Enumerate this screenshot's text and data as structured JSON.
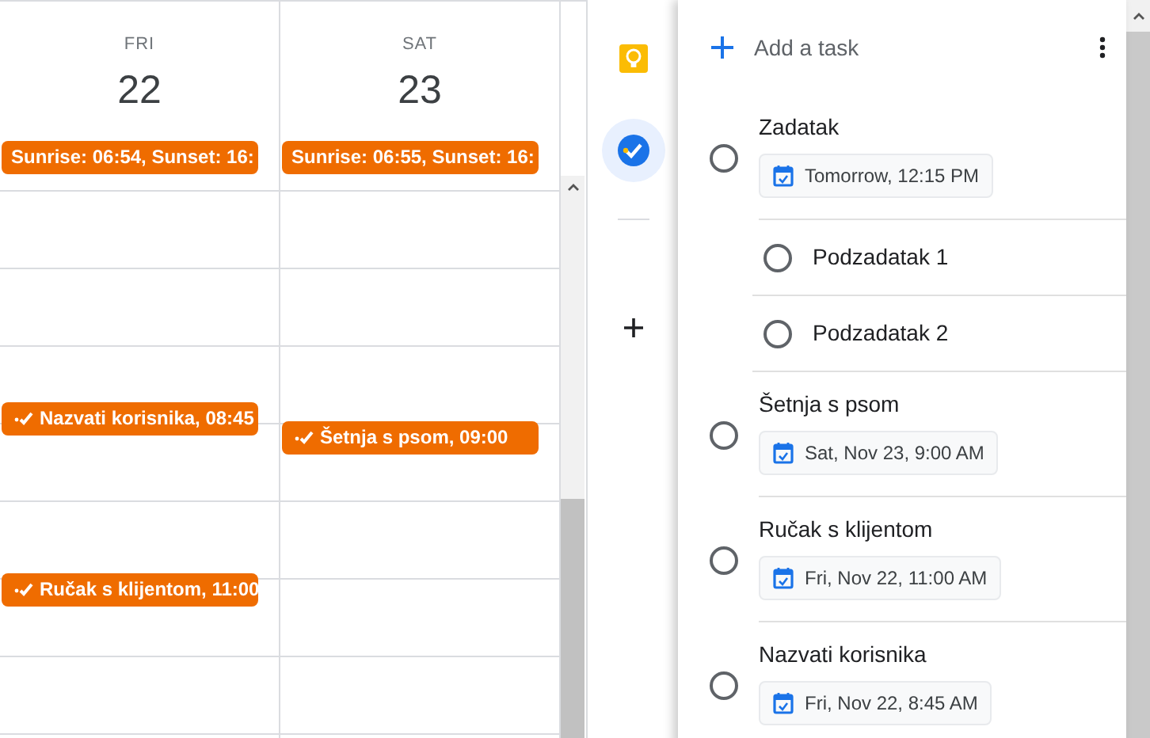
{
  "calendar": {
    "days": [
      {
        "name": "FRI",
        "date": "22",
        "all_day": "Sunrise: 06:54, Sunset: 16:",
        "events": [
          {
            "label": "Nazvati korisnika, 08:45"
          },
          {
            "label": "Ručak s klijentom, 11:00"
          }
        ]
      },
      {
        "name": "SAT",
        "date": "23",
        "all_day": "Sunrise: 06:55, Sunset: 16:",
        "events": [
          {
            "label": "Šetnja s psom, 09:00"
          }
        ]
      }
    ]
  },
  "side_rail": {
    "items": [
      {
        "kind": "keep",
        "selected": false
      },
      {
        "kind": "tasks",
        "selected": true
      },
      {
        "kind": "add",
        "selected": false
      }
    ]
  },
  "tasks_panel": {
    "add_task": {
      "placeholder": "Add a task"
    },
    "tasks": [
      {
        "title": "Zadatak",
        "due": "Tomorrow, 12:15 PM",
        "completed": false,
        "children": [
          {
            "title": "Podzadatak 1",
            "completed": false
          },
          {
            "title": "Podzadatak 2",
            "completed": false
          }
        ]
      },
      {
        "title": "Šetnja s psom",
        "due": "Sat, Nov 23, 9:00 AM",
        "completed": false
      },
      {
        "title": "Ručak s klijentom",
        "due": "Fri, Nov 22, 11:00 AM",
        "completed": false
      },
      {
        "title": "Nazvati korisnika",
        "due": "Fri, Nov 22, 8:45 AM",
        "completed": false
      }
    ]
  }
}
